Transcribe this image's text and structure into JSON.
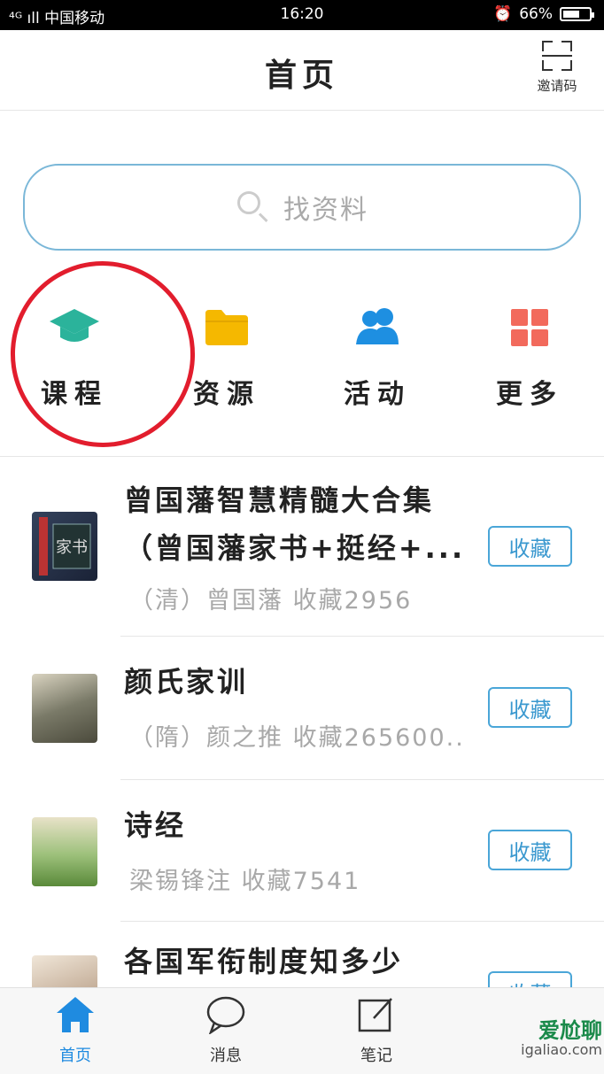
{
  "status_bar": {
    "left": "⁴ᴳ ıll 中国移动",
    "time": "16:20",
    "battery": "66%"
  },
  "header": {
    "title": "首页",
    "invite_label": "邀请码"
  },
  "search": {
    "placeholder": "找资料"
  },
  "nav": [
    {
      "label": "课程",
      "icon": "graduation-cap-icon",
      "color": "#2bb39b"
    },
    {
      "label": "资源",
      "icon": "folder-icon",
      "color": "#f5b800"
    },
    {
      "label": "活动",
      "icon": "people-icon",
      "color": "#1e8fe1"
    },
    {
      "label": "更多",
      "icon": "grid-icon",
      "color": "#f26a5c"
    }
  ],
  "list": [
    {
      "title": "曾国藩智慧精髓大合集（曾国藩家书+挺经+...",
      "subtitle": "（清）曾国藩 收藏2956",
      "button": "收藏"
    },
    {
      "title": "颜氏家训",
      "subtitle": "（隋）颜之推 收藏265600...",
      "button": "收藏"
    },
    {
      "title": "诗经",
      "subtitle": "梁锡锋注 收藏7541",
      "button": "收藏"
    },
    {
      "title": "各国军衔制度知多少",
      "subtitle": "",
      "button": "收藏"
    }
  ],
  "tabs": [
    {
      "label": "首页",
      "icon": "home-icon"
    },
    {
      "label": "消息",
      "icon": "chat-icon"
    },
    {
      "label": "笔记",
      "icon": "note-icon"
    }
  ],
  "watermark": {
    "brand": "爱尬聊",
    "url": "igaliao.com"
  },
  "colors": {
    "accent": "#1f8be0",
    "border": "#4aa6d8",
    "highlight_circle": "#e21d2d"
  }
}
